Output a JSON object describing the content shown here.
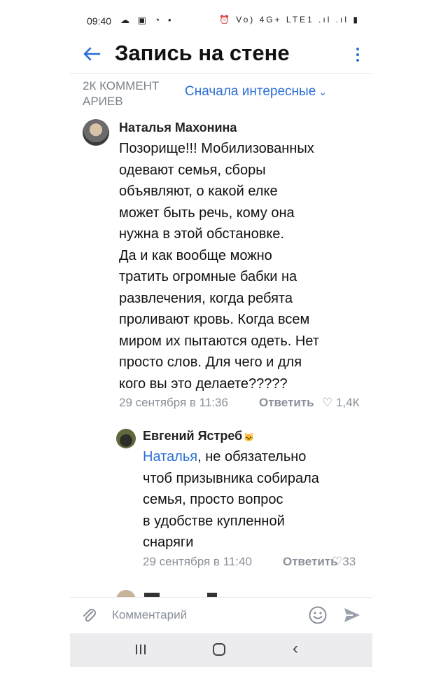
{
  "status_bar": {
    "time": "09:40",
    "left_icons": "☁ ▣ ◔ •",
    "right_icons": "⏰ Vo) 4G+ LTE1 .ıl .ıl ▮"
  },
  "header": {
    "title": "Запись на стене"
  },
  "sort_row": {
    "comment_count": "2К КОММЕНТ\nАРИЕВ",
    "sort_label": "Сначала интересные",
    "sort_chevron": "⌄"
  },
  "comments": [
    {
      "author": "Наталья Махонина",
      "text": "Позорище!!! Мобилизованных\nодевают семья, сборы\nобъявляют, о какой елке\nможет быть речь, кому она\nнужна в этой обстановке.\nДа и как вообще можно\nтратить огромные бабки на\nразвлечения, когда ребята\nпроливают кровь. Когда всем\nмиром их пытаются одеть. Нет\nпросто слов. Для чего и для\nкого вы это делаете?????",
      "date": "29 сентября в 11:36",
      "reply_label": "Ответить",
      "likes": "♡ 1,4К"
    },
    {
      "author": "Евгений Ястреб",
      "badge": "🐱",
      "mention": "Наталья",
      "text": ", не обязательно\nчтоб призывника собирала\nсемья, просто вопрос\nв удобстве купленной\nснаряги",
      "date": "29 сентября в 11:40",
      "reply_label": "Ответить",
      "likes": "♡33"
    }
  ],
  "input_bar": {
    "placeholder": "Комментарий"
  },
  "icons": {
    "back": "arrow-left-icon",
    "menu": "more-vertical-icon",
    "attach": "paperclip-icon",
    "emoji": "smile-icon",
    "send": "send-icon"
  },
  "colors": {
    "accent": "#2a6fd6",
    "muted_text": "#8a9099"
  }
}
